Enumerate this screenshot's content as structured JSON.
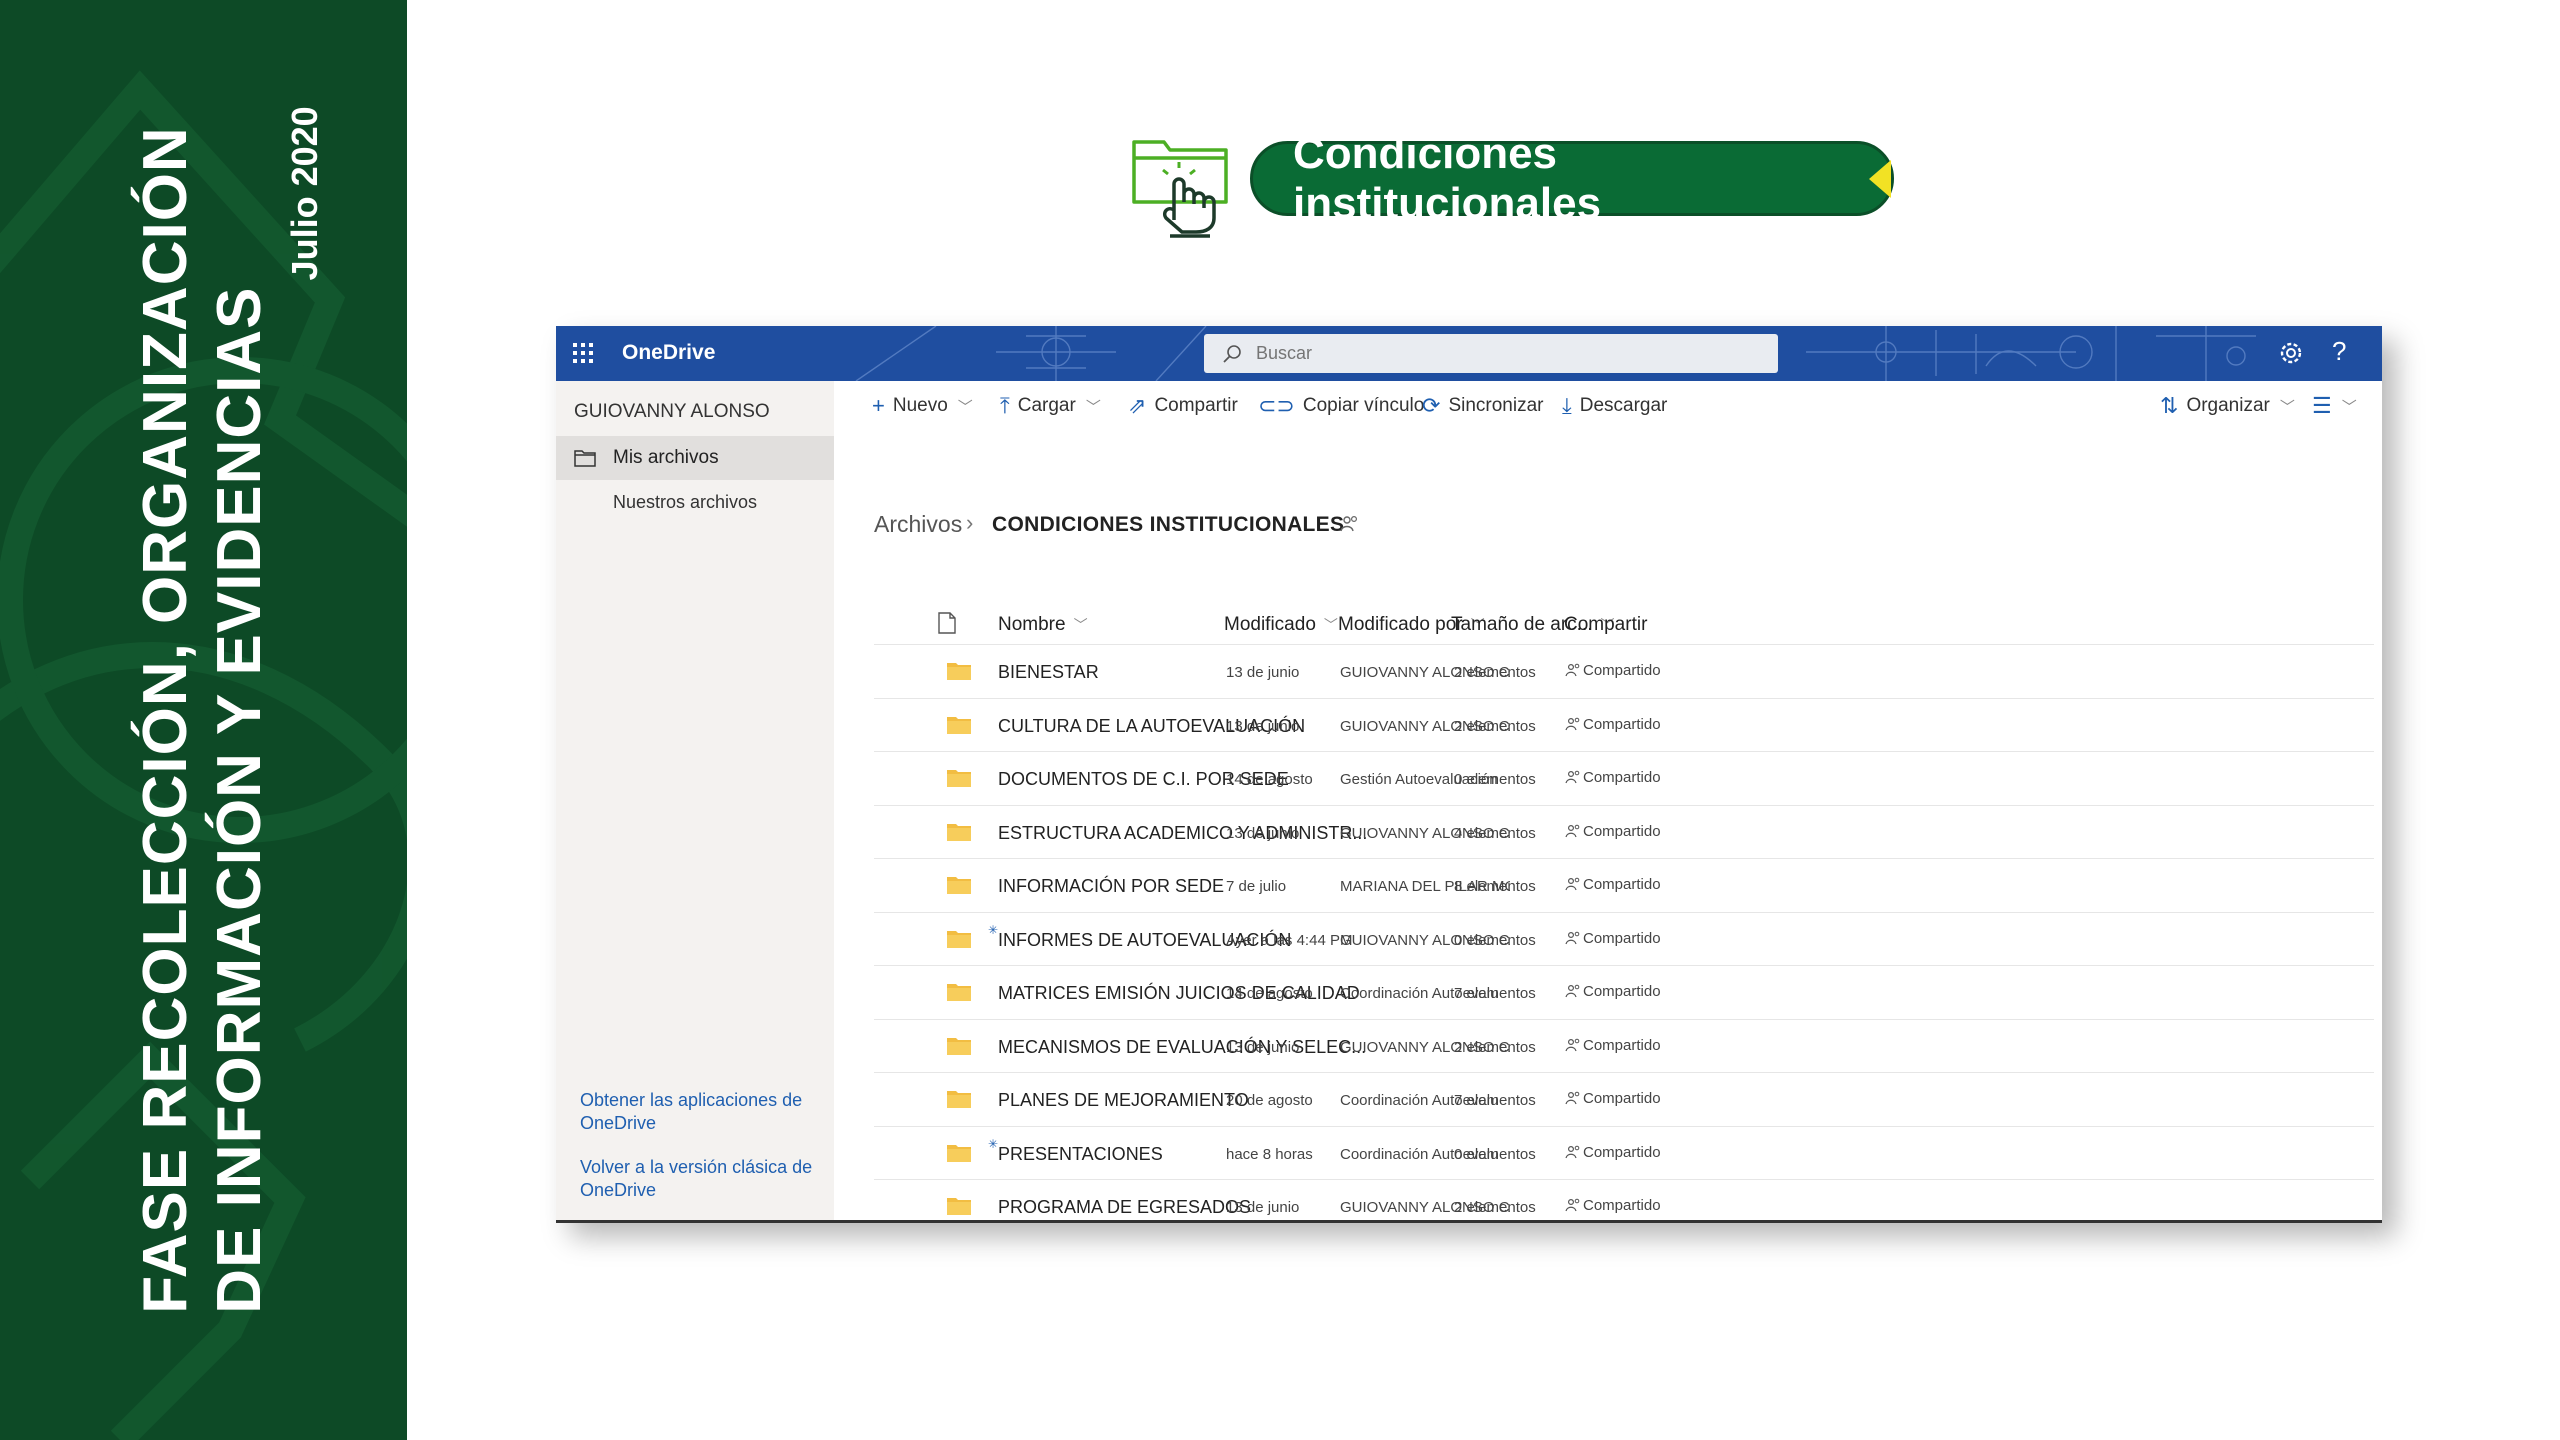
{
  "banner": {
    "line1": "FASE RECOLECCIÓN, ORGANIZACIÓN",
    "line2": "DE INFORMACIÓN Y EVIDENCIAS",
    "date": "Julio 2020",
    "color": "#0d4a26"
  },
  "header": {
    "title": "Condiciones institucionales",
    "pill_color": "#0a6b35",
    "arrow_color": "#f2e224",
    "icon": "folder-hand-click-icon"
  },
  "onedrive": {
    "brand": "OneDrive",
    "search_placeholder": "Buscar",
    "user": "GUIOVANNY ALONSO",
    "nav": [
      {
        "label": "Mis archivos",
        "active": true
      },
      {
        "label": "Nuestros archivos",
        "active": false
      }
    ],
    "footer_links": [
      "Obtener las aplicaciones de OneDrive",
      "Volver a la versión clásica de OneDrive"
    ],
    "commands": {
      "nuevo": "Nuevo",
      "cargar": "Cargar",
      "compartir": "Compartir",
      "copiar": "Copiar vínculo",
      "sincronizar": "Sincronizar",
      "descargar": "Descargar",
      "organizar": "Organizar"
    },
    "breadcrumb": {
      "root": "Archivos",
      "current": "CONDICIONES INSTITUCIONALES"
    },
    "columns": {
      "nombre": "Nombre",
      "modificado": "Modificado",
      "modificado_por": "Modificado por",
      "tamano": "Tamaño de arc...",
      "compartir": "Compartir"
    },
    "rows": [
      {
        "name": "BIENESTAR",
        "modified": "13 de junio",
        "by": "GUIOVANNY ALONSO CA",
        "size": "2 elementos",
        "share": "Compartido"
      },
      {
        "name": "CULTURA DE LA AUTOEVALUACIÓN",
        "modified": "13 de junio",
        "by": "GUIOVANNY ALONSO CA",
        "size": "2 elementos",
        "share": "Compartido"
      },
      {
        "name": "DOCUMENTOS DE C.I. POR SEDE",
        "modified": "14 de agosto",
        "by": "Gestión Autoevaluación",
        "size": "0 elementos",
        "share": "Compartido"
      },
      {
        "name": "ESTRUCTURA ACADEMICO Y ADMINISTR...",
        "modified": "13 de junio",
        "by": "GUIOVANNY ALONSO CA",
        "size": "4 elementos",
        "share": "Compartido"
      },
      {
        "name": "INFORMACIÓN POR SEDE",
        "modified": "7 de julio",
        "by": "MARIANA DEL PILAR MO",
        "size": "8 elementos",
        "share": "Compartido"
      },
      {
        "name": "INFORMES DE AUTOEVALUACIÓN",
        "modified": "Ayer a las 4:44 PM",
        "by": "GUIOVANNY ALONSO CA",
        "size": "0 elementos",
        "share": "Compartido"
      },
      {
        "name": "MATRICES EMISIÓN JUICIOS DE CALIDAD",
        "modified": "14 de agosto",
        "by": "Coordinación Autoevalu",
        "size": "7 elementos",
        "share": "Compartido"
      },
      {
        "name": "MECANISMOS DE EVALUACIÓN Y SELEC...",
        "modified": "13 de junio",
        "by": "GUIOVANNY ALONSO CA",
        "size": "2 elementos",
        "share": "Compartido"
      },
      {
        "name": "PLANES DE MEJORAMIENTO",
        "modified": "20 de agosto",
        "by": "Coordinación Autoevalu",
        "size": "7 elementos",
        "share": "Compartido"
      },
      {
        "name": "PRESENTACIONES",
        "modified": "hace 8 horas",
        "by": "Coordinación Autoevalu",
        "size": "0 elementos",
        "share": "Compartido"
      },
      {
        "name": "PROGRAMA DE EGRESADOS",
        "modified": "13 de junio",
        "by": "GUIOVANNY ALONSO CA",
        "size": "2 elementos",
        "share": "Compartido"
      }
    ],
    "topbar_color": "#1f4ea0",
    "folder_color": "#f2bd42"
  }
}
